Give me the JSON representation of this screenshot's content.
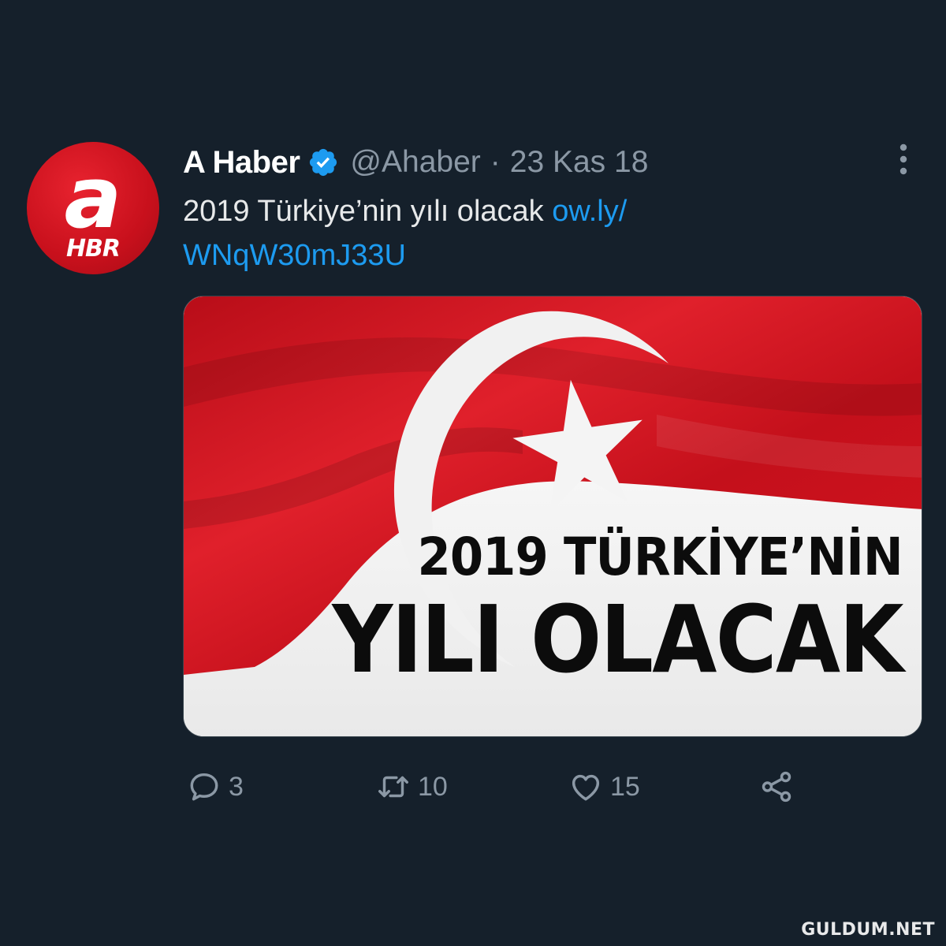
{
  "tweet": {
    "author": {
      "name": "A Haber",
      "handle": "@Ahaber",
      "verified": true,
      "avatar_logo": "a",
      "avatar_sub": "HBR"
    },
    "separator": "·",
    "date": "23 Kas 18",
    "text": "2019 Türkiye’nin yılı olacak ",
    "link_part1": "ow.ly/",
    "link_part2": "WNqW30mJ33U",
    "media": {
      "headline_line1": "2019 TÜRKİYE’NİN",
      "headline_line2": "YILI OLACAK"
    },
    "actions": {
      "reply_count": "3",
      "retweet_count": "10",
      "like_count": "15"
    }
  },
  "icons": {
    "more": "more-vertical-icon",
    "verified": "verified-badge-icon",
    "reply": "reply-icon",
    "retweet": "retweet-icon",
    "like": "heart-icon",
    "share": "share-icon"
  },
  "colors": {
    "background": "#15202b",
    "link": "#1d9bf0",
    "muted": "#8b98a5",
    "flag_red": "#d0121e"
  },
  "watermark": "GULDUM.NET"
}
